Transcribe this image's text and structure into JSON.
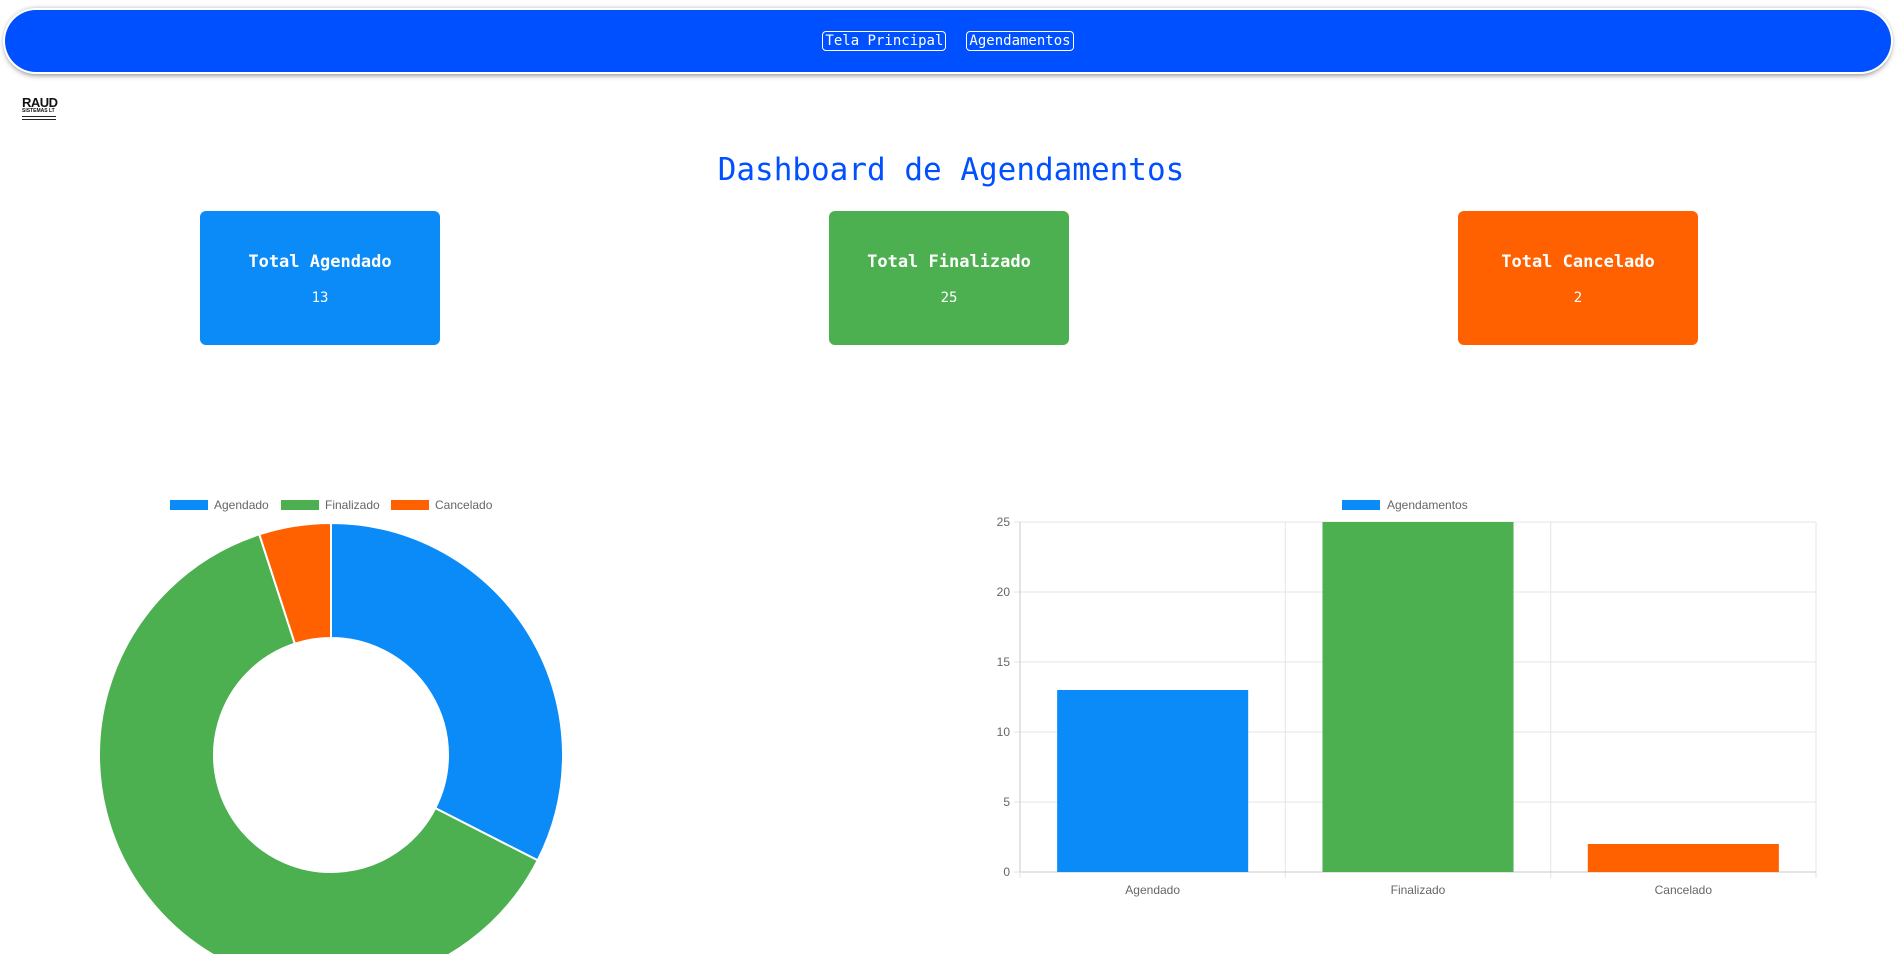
{
  "nav": {
    "home_label": "Tela Principal",
    "appointments_label": "Agendamentos"
  },
  "logo": {
    "text": "RAUD",
    "subtext": "SISTEMAS LT"
  },
  "page": {
    "title": "Dashboard de Agendamentos"
  },
  "cards": [
    {
      "title": "Total Agendado",
      "value": "13",
      "color": "#0a8bf7"
    },
    {
      "title": "Total Finalizado",
      "value": "25",
      "color": "#4caf50"
    },
    {
      "title": "Total Cancelado",
      "value": "2",
      "color": "#ff6000"
    }
  ],
  "colors": {
    "agendado": "#0a8bf7",
    "finalizado": "#4caf50",
    "cancelado": "#ff6000",
    "accent": "#0050ff"
  },
  "chart_data": [
    {
      "type": "pie",
      "variant": "doughnut",
      "categories": [
        "Agendado",
        "Finalizado",
        "Cancelado"
      ],
      "values": [
        13,
        25,
        2
      ],
      "colors": [
        "#0a8bf7",
        "#4caf50",
        "#ff6000"
      ],
      "legend": "top"
    },
    {
      "type": "bar",
      "categories": [
        "Agendado",
        "Finalizado",
        "Cancelado"
      ],
      "series": [
        {
          "name": "Agendamentos",
          "values": [
            13,
            25,
            2
          ]
        }
      ],
      "colors": [
        "#0a8bf7",
        "#4caf50",
        "#ff6000"
      ],
      "ylim": [
        0,
        25
      ],
      "yticks": [
        "0",
        "5",
        "10",
        "15",
        "20",
        "25"
      ],
      "grid": true,
      "legend": "top"
    }
  ]
}
